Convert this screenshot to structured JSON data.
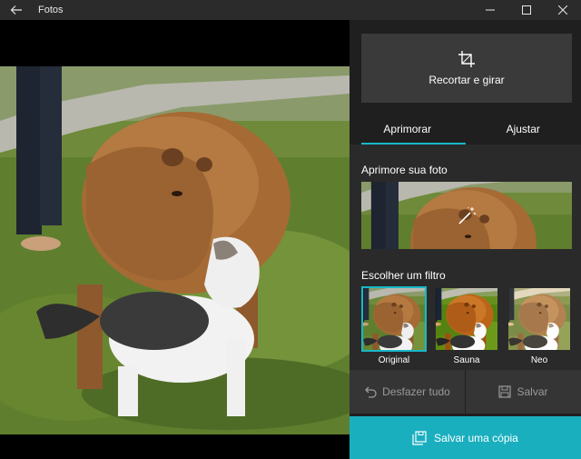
{
  "window": {
    "title": "Fotos"
  },
  "panel": {
    "crop_label": "Recortar e girar",
    "tabs": [
      {
        "label": "Aprimorar",
        "active": true
      },
      {
        "label": "Ajustar",
        "active": false
      }
    ],
    "enhance_title": "Aprimore sua foto",
    "filter_title": "Escolher um filtro",
    "filters": [
      {
        "label": "Original",
        "selected": true
      },
      {
        "label": "Sauna",
        "selected": false
      },
      {
        "label": "Neo",
        "selected": false
      }
    ],
    "undo_label": "Desfazer tudo",
    "save_label": "Salvar",
    "save_copy_label": "Salvar uma cópia"
  },
  "colors": {
    "accent": "#1aafbf",
    "titlebar": "#2b2b2b",
    "panel": "#1f1f1f"
  },
  "icons": {
    "back": "back-arrow-icon",
    "minimize": "minimize-icon",
    "maximize": "maximize-icon",
    "close": "close-icon",
    "crop": "crop-icon",
    "magic_wand": "magic-wand-icon",
    "undo": "undo-icon",
    "save": "save-icon",
    "save_copy": "save-copy-icon"
  }
}
